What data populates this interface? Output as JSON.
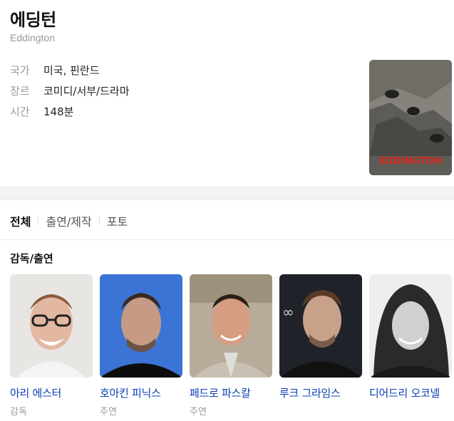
{
  "movie": {
    "title": "에딩턴",
    "original_title": "Eddington",
    "info": [
      {
        "key": "국가",
        "value": "미국, 핀란드"
      },
      {
        "key": "장르",
        "value": "코미디/서부/드라마"
      },
      {
        "key": "시간",
        "value": "148분"
      }
    ],
    "poster": {
      "text": "EDDINGTON",
      "accent": "#d9271c"
    }
  },
  "tabs": [
    {
      "label": "전체",
      "active": true
    },
    {
      "label": "출연/제작",
      "active": false
    },
    {
      "label": "포토",
      "active": false
    }
  ],
  "section": {
    "title": "감독/출연"
  },
  "cast": [
    {
      "name": "아리 에스터",
      "role": "감독"
    },
    {
      "name": "호아킨 피닉스",
      "role": "주연"
    },
    {
      "name": "페드로 파스칼",
      "role": "주연"
    },
    {
      "name": "루크 그라임스",
      "role": ""
    },
    {
      "name": "디어드리 오코넬",
      "role": ""
    }
  ],
  "colors": {
    "link": "#0b3db5",
    "muted": "#999999",
    "gap": "#f2f3f5"
  }
}
